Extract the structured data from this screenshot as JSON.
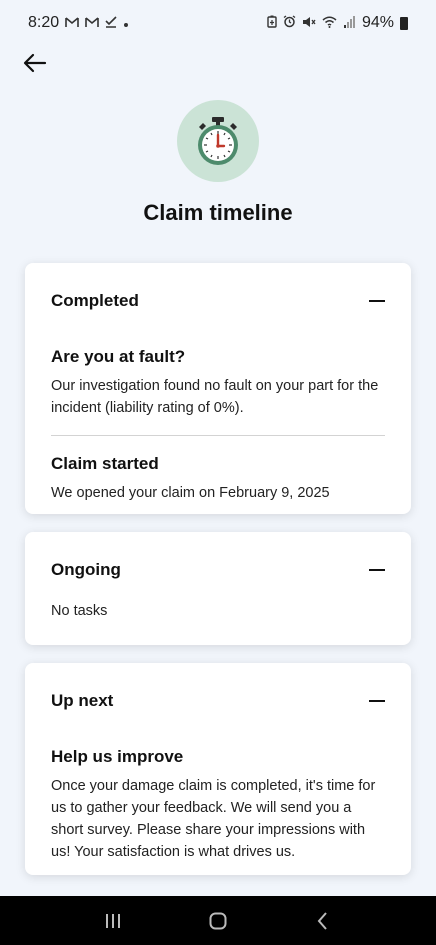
{
  "status_bar": {
    "time": "8:20",
    "left_icons": [
      "gmail-icon",
      "gmail-icon",
      "download-done-icon",
      "dot-icon"
    ],
    "right_icons": [
      "battery-saver-icon",
      "alarm-icon",
      "mute-icon",
      "wifi-icon",
      "signal-icon"
    ],
    "battery": "94%"
  },
  "header": {
    "title": "Claim timeline",
    "hero_icon": "stopwatch-icon",
    "hero_color": "#cbe3d6",
    "accent_red": "#c0392b"
  },
  "cards": {
    "completed": {
      "title": "Completed",
      "items": [
        {
          "title": "Are you at fault?",
          "body": "Our investigation found no fault on your part for the incident (liability rating of 0%)."
        },
        {
          "title": "Claim started",
          "body": "We opened your claim on February 9, 2025"
        }
      ]
    },
    "ongoing": {
      "title": "Ongoing",
      "body": "No tasks"
    },
    "up_next": {
      "title": "Up next",
      "items": [
        {
          "title": "Help us improve",
          "body": "Once your damage claim is completed, it's time for us to gather your feedback. We will send you a short survey. Please share your impressions with us! Your satisfaction is what drives us."
        }
      ]
    }
  },
  "nav_bar": {
    "buttons": [
      "recent-apps-icon",
      "home-icon",
      "back-icon"
    ]
  }
}
